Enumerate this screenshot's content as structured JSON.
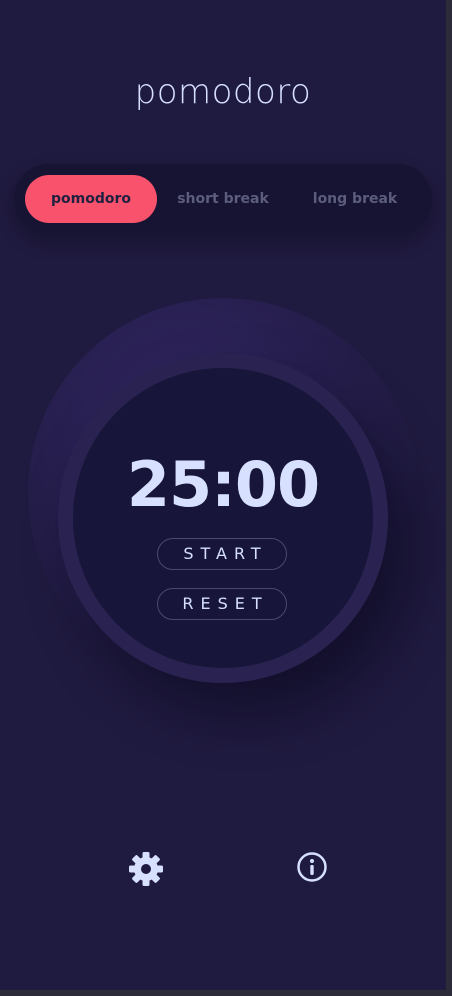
{
  "app": {
    "title": "pomodoro"
  },
  "modes": [
    {
      "label": "pomodoro",
      "active": true
    },
    {
      "label": "short break",
      "active": false
    },
    {
      "label": "long break",
      "active": false
    }
  ],
  "timer": {
    "time": "25:00",
    "start_label": "START",
    "reset_label": "RESET"
  },
  "footer": {
    "icons": [
      "gear-icon",
      "info-icon"
    ]
  },
  "colors": {
    "background": "#1f1a3f",
    "accent": "#f9526c",
    "text": "#d7e0ff",
    "muted": "#5c5d7e"
  }
}
